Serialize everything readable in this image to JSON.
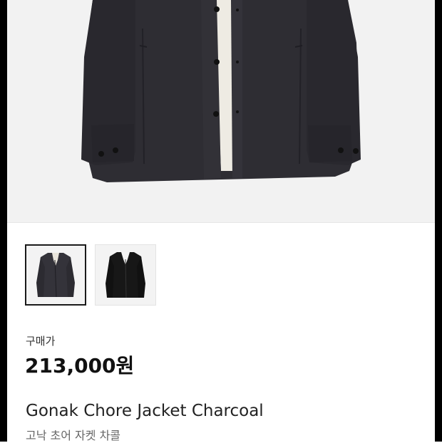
{
  "product": {
    "price_label": "구매가",
    "price": "213,000원",
    "name": "Gonak Chore Jacket Charcoal",
    "name_ko": "고낙 초어 자켓 차콜"
  },
  "images": {
    "main": "charcoal-jacket-front",
    "thumbnails": [
      {
        "name": "charcoal-jacket-thumbnail",
        "selected": true
      },
      {
        "name": "black-jacket-thumbnail",
        "selected": false
      }
    ]
  },
  "colors": {
    "jacket_charcoal": "#2f2e33",
    "jacket_black": "#141414",
    "background": "#f2f2f2"
  }
}
